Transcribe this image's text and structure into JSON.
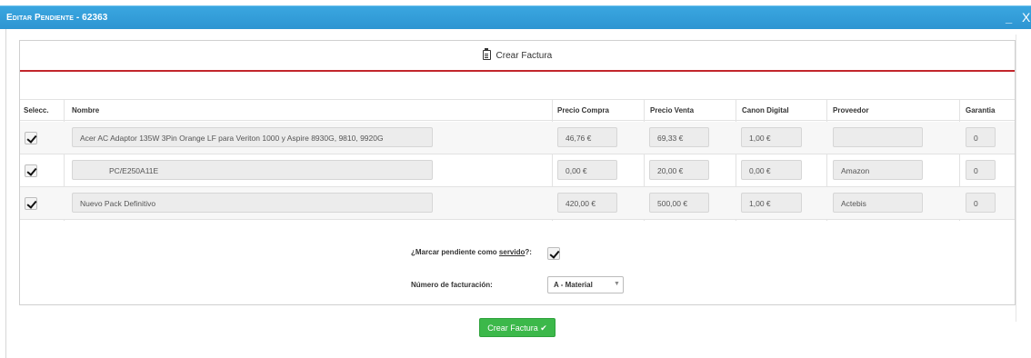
{
  "window": {
    "title": "Editar Pendiente - 62363",
    "minimize": "_",
    "close": "X"
  },
  "panel": {
    "header": "Crear Factura"
  },
  "table": {
    "columns": [
      "Selecc.",
      "Nombre",
      "Precio Compra",
      "Precio Venta",
      "Canon Digital",
      "Proveedor",
      "Garantia"
    ],
    "rows": [
      {
        "selected": true,
        "nombre": "Acer AC Adaptor 135W 3Pin Orange LF para Veriton 1000 y Aspire 8930G, 9810, 9920G",
        "precio_compra": "46,76 €",
        "precio_venta": "69,33 €",
        "canon_digital": "1,00 €",
        "proveedor": "",
        "garantia": "0"
      },
      {
        "selected": true,
        "nombre": "PC/E250A11E",
        "precio_compra": "0,00 €",
        "precio_venta": "20,00 €",
        "canon_digital": "0,00 €",
        "proveedor": "Amazon",
        "garantia": "0"
      },
      {
        "selected": true,
        "nombre": "Nuevo Pack Definitivo",
        "precio_compra": "420,00 €",
        "precio_venta": "500,00 €",
        "canon_digital": "1,00 €",
        "proveedor": "Actebis",
        "garantia": "0"
      }
    ]
  },
  "form": {
    "served_label_pre": "¿Marcar pendiente como ",
    "served_label_link": "servido",
    "served_label_post": "?:",
    "served_checked": true,
    "billing_label": "Número de facturación:",
    "billing_value": "A - Material"
  },
  "submit_label": "Crear Factura ✔",
  "colors": {
    "titlebar": "#2d95d2",
    "accent_red": "#c2262c",
    "submit_green": "#3cb84a"
  }
}
